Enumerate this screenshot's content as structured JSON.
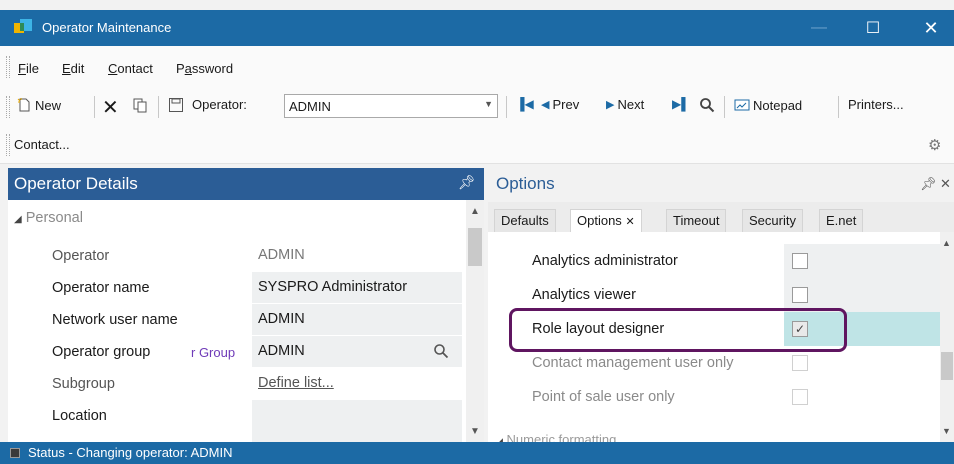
{
  "window": {
    "title": "Operator Maintenance",
    "minimize": "—",
    "maximize": "☐",
    "close": "✕"
  },
  "menu": [
    "File",
    "Edit",
    "Contact",
    "Password"
  ],
  "toolbar": {
    "new_label": "New",
    "operator_label": "Operator:",
    "operator_value": "ADMIN",
    "prev_label": "Prev",
    "next_label": "Next",
    "notepad_label": "Notepad",
    "printers_label": "Printers..."
  },
  "contactbar": {
    "contact_label": "Contact..."
  },
  "left_panel": {
    "title": "Operator Details",
    "section": "Personal",
    "rows": [
      {
        "label": "Operator",
        "value": "ADMIN"
      },
      {
        "label": "Operator name",
        "value": "SYSPRO Administrator"
      },
      {
        "label": "Network user name",
        "value": "ADMIN"
      },
      {
        "label": "Operator group",
        "value": "ADMIN",
        "overlay": "r Group"
      },
      {
        "label": "Subgroup",
        "value": "Define list..."
      },
      {
        "label": "Location",
        "value": ""
      }
    ]
  },
  "right_panel": {
    "title": "Options",
    "tabs": [
      "Defaults",
      "Options",
      "Timeout",
      "Security",
      "E.net"
    ],
    "active_tab": "Options",
    "options": [
      {
        "label": "Analytics administrator",
        "checked": false,
        "enabled": true
      },
      {
        "label": "Analytics viewer",
        "checked": false,
        "enabled": true
      },
      {
        "label": "Role layout designer",
        "checked": true,
        "enabled": true
      },
      {
        "label": "Contact management user only",
        "checked": false,
        "enabled": false
      },
      {
        "label": "Point of sale user only",
        "checked": false,
        "enabled": false
      }
    ],
    "next_section": "Numeric formatting"
  },
  "status": {
    "text": "Status - Changing operator: ADMIN"
  },
  "colors": {
    "titlebar": "#1c6aa5",
    "panel_header": "#2b5d96",
    "highlight": "#5f1560",
    "selected_row": "#bfe4e6"
  }
}
